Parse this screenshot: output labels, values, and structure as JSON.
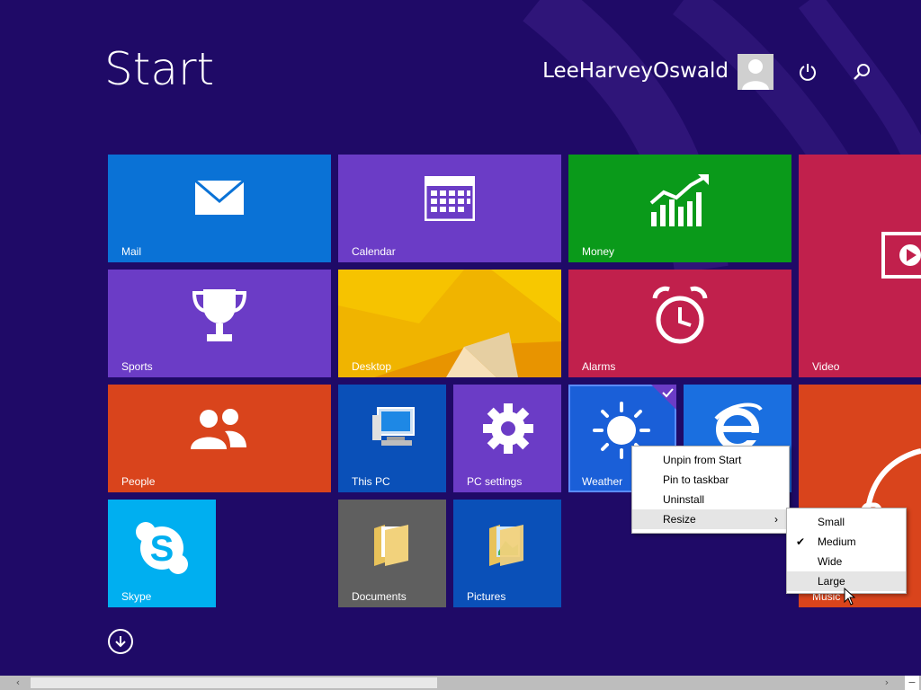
{
  "screen": {
    "title": "Start"
  },
  "user": {
    "name": "LeeHarveyOswald",
    "avatar_icon": "user-silhouette-icon"
  },
  "top_icons": {
    "power": "power-icon",
    "search": "search-icon"
  },
  "tiles": [
    {
      "id": "mail",
      "label": "Mail",
      "color": "#0a72d6",
      "icon": "envelope-icon"
    },
    {
      "id": "calendar",
      "label": "Calendar",
      "color": "#6b3cc6",
      "icon": "calendar-icon"
    },
    {
      "id": "money",
      "label": "Money",
      "color": "#0a9a1a",
      "icon": "chart-icon"
    },
    {
      "id": "video",
      "label": "Video",
      "color": "#c1204c",
      "icon": "play-icon"
    },
    {
      "id": "sports",
      "label": "Sports",
      "color": "#6b3cc6",
      "icon": "trophy-icon"
    },
    {
      "id": "desktop",
      "label": "Desktop",
      "color": "#e8a300",
      "icon": "desktop-wallpaper"
    },
    {
      "id": "alarms",
      "label": "Alarms",
      "color": "#c1204c",
      "icon": "alarm-clock-icon"
    },
    {
      "id": "people",
      "label": "People",
      "color": "#d9441c",
      "icon": "people-icon"
    },
    {
      "id": "this_pc",
      "label": "This PC",
      "color": "#0a50b8",
      "icon": "computer-icon"
    },
    {
      "id": "pc_settings",
      "label": "PC settings",
      "color": "#6b3cc6",
      "icon": "gear-icon"
    },
    {
      "id": "weather",
      "label": "Weather",
      "color": "#1a5fd8",
      "icon": "sun-icon",
      "selected": true
    },
    {
      "id": "ie",
      "label": "",
      "color": "#1a6fe0",
      "icon": "internet-explorer-icon"
    },
    {
      "id": "music",
      "label": "Music",
      "color": "#d9441c",
      "icon": "headphones-icon"
    },
    {
      "id": "skype",
      "label": "Skype",
      "color": "#00aff0",
      "icon": "skype-icon"
    },
    {
      "id": "documents",
      "label": "Documents",
      "color": "#5f5f5f",
      "icon": "folder-icon"
    },
    {
      "id": "pictures",
      "label": "Pictures",
      "color": "#0a50b8",
      "icon": "folder-icon"
    }
  ],
  "context_menu": {
    "items": [
      {
        "label": "Unpin from Start"
      },
      {
        "label": "Pin to taskbar"
      },
      {
        "label": "Uninstall"
      },
      {
        "label": "Resize",
        "has_submenu": true,
        "highlighted": true
      }
    ]
  },
  "resize_submenu": {
    "items": [
      {
        "label": "Small",
        "checked": false
      },
      {
        "label": "Medium",
        "checked": true
      },
      {
        "label": "Wide",
        "checked": false
      },
      {
        "label": "Large",
        "checked": false,
        "hover": true
      }
    ]
  },
  "scrollbar": {
    "left_arrow": "‹",
    "right_arrow": "›",
    "collapse": "−"
  }
}
